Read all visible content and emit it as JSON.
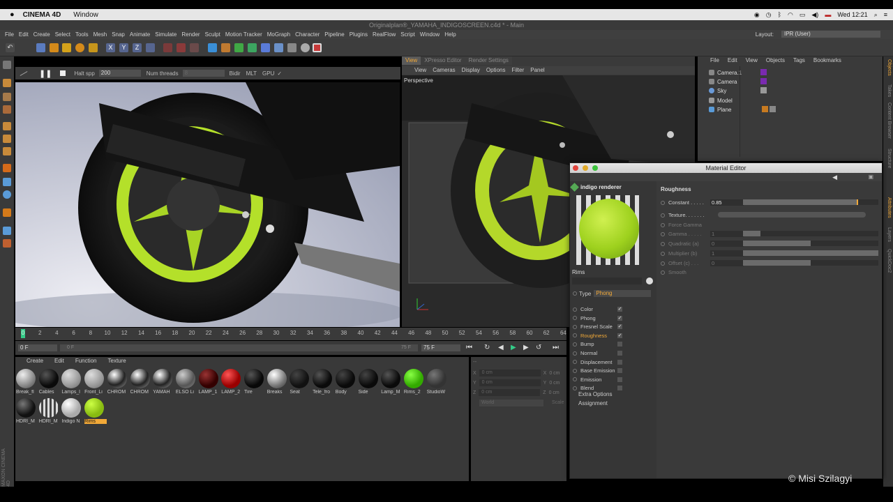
{
  "mac_menubar": {
    "app_name": "CINEMA 4D",
    "menu_window": "Window",
    "clock": "Wed 12:21"
  },
  "window_title": "Originalplan®_YAMAHA_INDIGOSCREEN.c4d * - Main",
  "main_menu": [
    "File",
    "Edit",
    "Create",
    "Select",
    "Tools",
    "Mesh",
    "Snap",
    "Animate",
    "Simulate",
    "Render",
    "Sculpt",
    "Motion Tracker",
    "MoGraph",
    "Character",
    "Pipeline",
    "Plugins",
    "RealFlow",
    "Script",
    "Window",
    "Help"
  ],
  "layout": {
    "label": "Layout:",
    "value": "IPR (User)"
  },
  "ipr_bar": {
    "halt_label": "Halt spp",
    "halt_value": "200",
    "threads_label": "Num threads",
    "threads_value": "8",
    "bidir": "Bidir",
    "mlt": "MLT",
    "gpu": "GPU",
    "gpu_check": "✓"
  },
  "viewport": {
    "tabs": [
      "View",
      "XPresso Editor",
      "Render Settings"
    ],
    "menu": [
      "View",
      "Cameras",
      "Display",
      "Options",
      "Filter",
      "Panel"
    ],
    "label": "Perspective"
  },
  "object_manager": {
    "menu": [
      "File",
      "Edit",
      "View",
      "Objects",
      "Tags",
      "Bookmarks"
    ],
    "objects": [
      "Camera.1",
      "Camera",
      "Sky",
      "Model",
      "Plane"
    ]
  },
  "timeline": {
    "ticks": [
      "0",
      "2",
      "4",
      "6",
      "8",
      "10",
      "12",
      "14",
      "16",
      "18",
      "20",
      "22",
      "24",
      "26",
      "28",
      "30",
      "32",
      "34",
      "36",
      "38",
      "40",
      "42",
      "44",
      "46",
      "48",
      "50",
      "52",
      "54",
      "56",
      "58",
      "60",
      "62",
      "64"
    ],
    "start_field": "0 F",
    "range_start": "0 F",
    "range_end": "75 F",
    "end_field": "75 F"
  },
  "material_manager": {
    "menu": [
      "Create",
      "Edit",
      "Function",
      "Texture"
    ],
    "materials": [
      "Break_fl",
      "Cables",
      "Lamps_l",
      "Front_Li",
      "CHROM",
      "CHROM",
      "YAMAH",
      "ELSO Li",
      "LAMP_1",
      "LAMP_2",
      "Tire",
      "Breaks",
      "Seat",
      "Tele_fro",
      "Body",
      "Side",
      "Lamp_M",
      "Rims_2",
      "StudioW",
      "HDRI_M",
      "HDRI_M",
      "Indigo N",
      "Rims"
    ]
  },
  "coordinates": {
    "rows": [
      {
        "axis": "X",
        "value": "0 cm",
        "axis2": "X",
        "value2": "0 cm"
      },
      {
        "axis": "Y",
        "value": "0 cm",
        "axis2": "Y",
        "value2": "0 cm"
      },
      {
        "axis": "Z",
        "value": "0 cm",
        "axis2": "Z",
        "value2": "0 cm"
      }
    ],
    "mode": "World",
    "scale": "Scale"
  },
  "material_editor": {
    "title": "Material Editor",
    "renderer": "indigo renderer",
    "material_name": "Rims",
    "type_label": "Type",
    "type_value": "Phong",
    "channels": [
      {
        "label": "Color",
        "checked": "✓"
      },
      {
        "label": "Phong",
        "checked": "✓"
      },
      {
        "label": "Fresnel Scale",
        "checked": "✓"
      },
      {
        "label": "Roughness",
        "checked": "✓"
      },
      {
        "label": "Bump",
        "checked": ""
      },
      {
        "label": "Normal",
        "checked": ""
      },
      {
        "label": "Displacement",
        "checked": ""
      },
      {
        "label": "Base Emission",
        "checked": ""
      },
      {
        "label": "Emission",
        "checked": ""
      },
      {
        "label": "Blend",
        "checked": ""
      }
    ],
    "extra_options": "Extra Options",
    "assignment": "Assignment",
    "section": "Roughness",
    "params": [
      {
        "label": "Constant . . . . .",
        "value": "0.85"
      },
      {
        "label": "Texture. . . . . . ."
      },
      {
        "label": "Force Gamma"
      },
      {
        "label": "Gamma . . . . .",
        "value": "1"
      },
      {
        "label": "Quadratic (a)",
        "value": "0"
      },
      {
        "label": "Multiplier (b)",
        "value": "1"
      },
      {
        "label": "Offset (c) . . .",
        "value": "0"
      },
      {
        "label": "Smooth"
      }
    ],
    "constant_level": 0.85
  },
  "side_tabs": [
    "Objects",
    "Takes",
    "Content Browser",
    "Structure",
    "Attributes",
    "Layers",
    "QuickDoc2"
  ],
  "watermark": "© Misi Szilagyi",
  "colors": {
    "accent": "#f2a938",
    "rim_green": "#b4e02a"
  }
}
